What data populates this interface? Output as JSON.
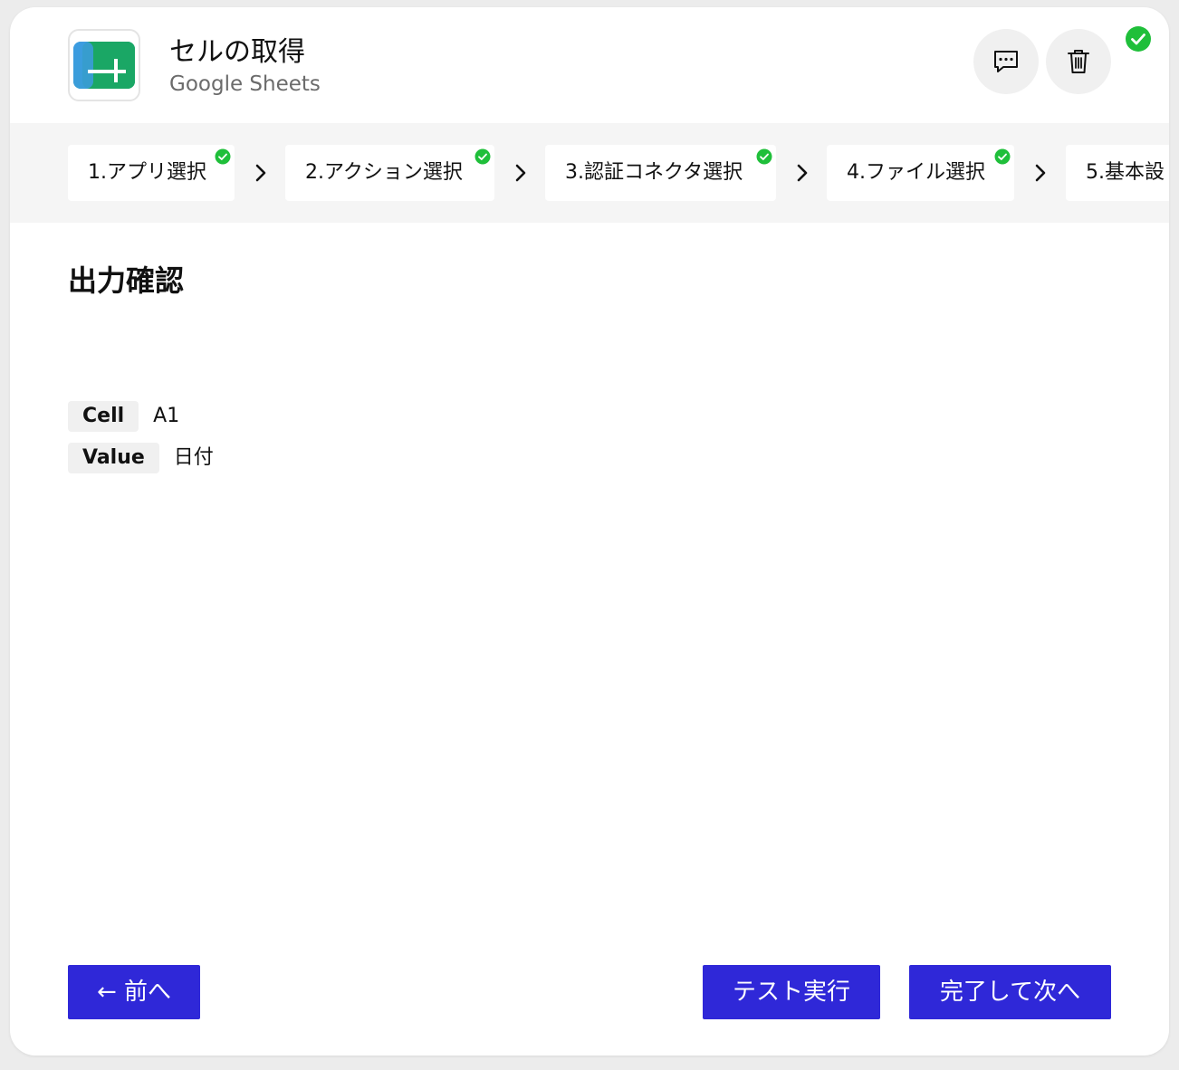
{
  "header": {
    "title": "セルの取得",
    "app_name": "Google Sheets",
    "icon": "google-sheets-icon",
    "comment_icon": "comment-icon",
    "delete_icon": "trash-icon",
    "status_icon": "check-circle-icon"
  },
  "steps": [
    {
      "label": "1.アプリ選択",
      "completed": true
    },
    {
      "label": "2.アクション選択",
      "completed": true
    },
    {
      "label": "3.認証コネクタ選択",
      "completed": true
    },
    {
      "label": "4.ファイル選択",
      "completed": true
    },
    {
      "label": "5.基本設",
      "completed": false
    }
  ],
  "section": {
    "title": "出力確認"
  },
  "outputs": [
    {
      "key": "Cell",
      "value": "A1"
    },
    {
      "key": "Value",
      "value": "日付"
    }
  ],
  "footer": {
    "prev_label": "← 前へ",
    "test_label": "テスト実行",
    "next_label": "完了して次へ"
  },
  "colors": {
    "primary": "#2f28d8",
    "success": "#1fbf3a",
    "sheets_green": "#1aa765"
  }
}
